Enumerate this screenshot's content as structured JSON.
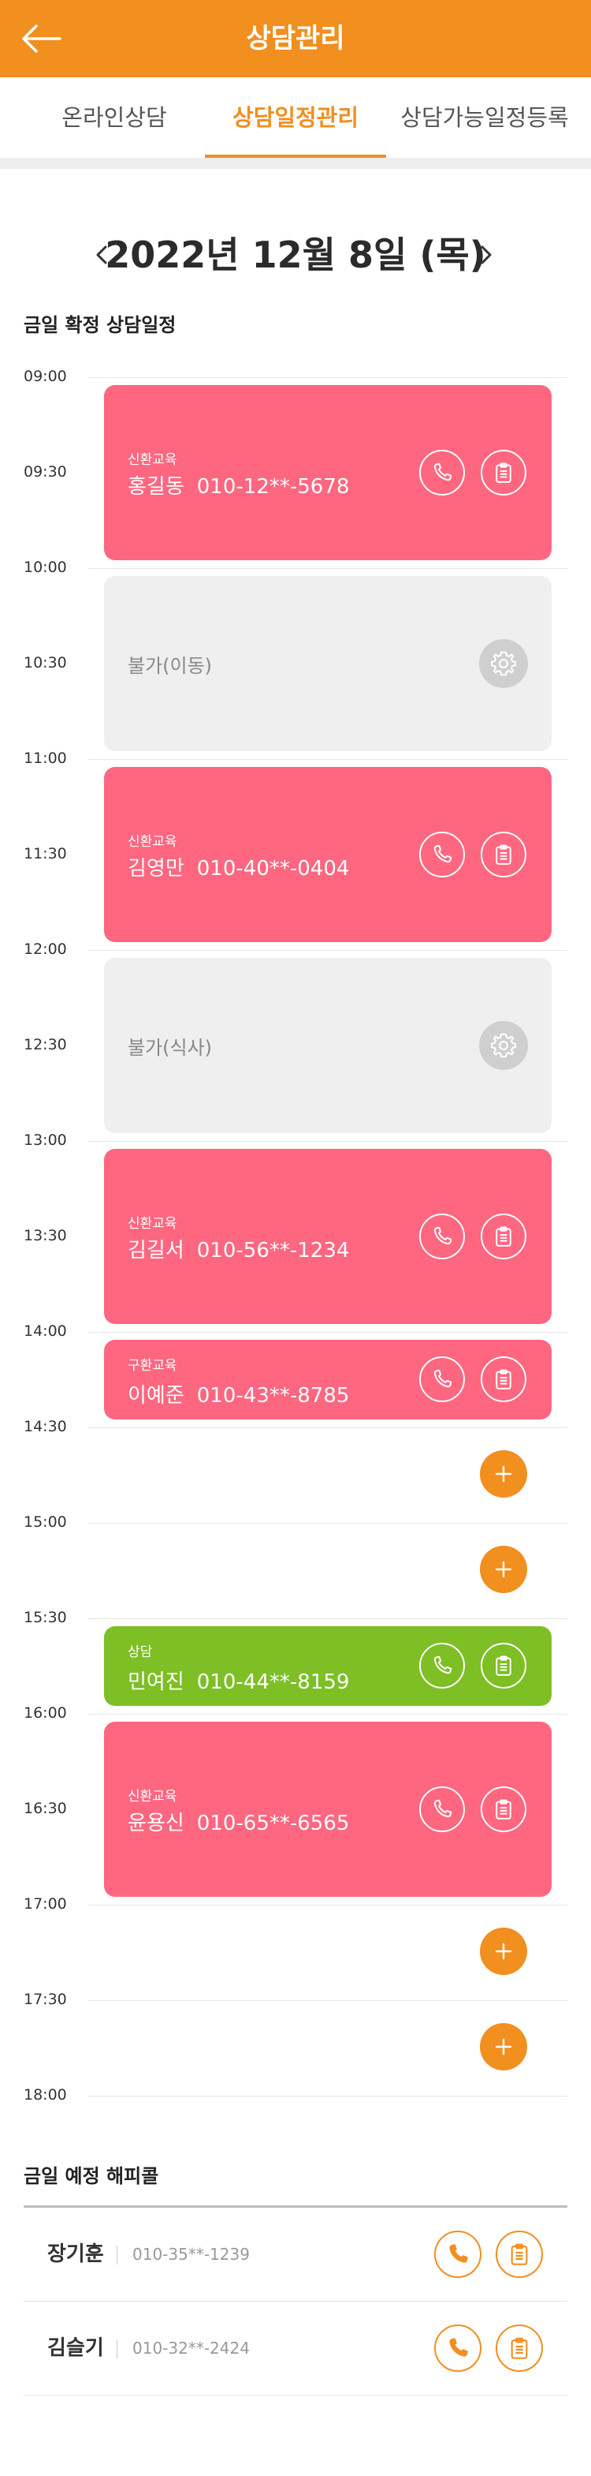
{
  "header": {
    "title": "상담관리",
    "back_icon": "arrow-left-icon"
  },
  "tabs": [
    {
      "label": "온라인상담",
      "active": false
    },
    {
      "label": "상담일정관리",
      "active": true
    },
    {
      "label": "상담가능일정등록",
      "active": false
    }
  ],
  "date": {
    "text": "2022년 12월 8일 (목)",
    "prev_icon": "chevron-left-icon",
    "next_icon": "chevron-right-icon"
  },
  "schedule": {
    "title": "금일 확정 상담일정",
    "times": [
      "09:00",
      "09:30",
      "10:00",
      "10:30",
      "11:00",
      "11:30",
      "12:00",
      "12:30",
      "13:00",
      "13:30",
      "14:00",
      "14:30",
      "15:00",
      "15:30",
      "16:00",
      "16:30",
      "17:00",
      "17:30",
      "18:00"
    ],
    "cards": [
      {
        "type": "booked",
        "category": "신환교육",
        "name": "홍길동",
        "phone": "010-12**-5678"
      },
      {
        "type": "blocked",
        "label": "불가(이동)"
      },
      {
        "type": "booked",
        "category": "신환교육",
        "name": "김영만",
        "phone": "010-40**-0404"
      },
      {
        "type": "blocked",
        "label": "불가(식사)"
      },
      {
        "type": "booked",
        "category": "신환교육",
        "name": "김길서",
        "phone": "010-56**-1234"
      },
      {
        "type": "booked",
        "category": "구환교육",
        "name": "이예준",
        "phone": "010-43**-8785"
      },
      {
        "type": "consult",
        "category": "상담",
        "name": "민여진",
        "phone": "010-44**-8159"
      },
      {
        "type": "booked",
        "category": "신환교육",
        "name": "윤용신",
        "phone": "010-65**-6565"
      }
    ]
  },
  "happycall": {
    "title": "금일 예정 해피콜",
    "items": [
      {
        "name": "장기훈",
        "phone": "010-35**-1239"
      },
      {
        "name": "김슬기",
        "phone": "010-32**-2424"
      }
    ]
  },
  "colors": {
    "accent": "#F18F1F",
    "booked": "#FF6680",
    "consult": "#7DBF24",
    "blocked": "#EFEFEF"
  }
}
